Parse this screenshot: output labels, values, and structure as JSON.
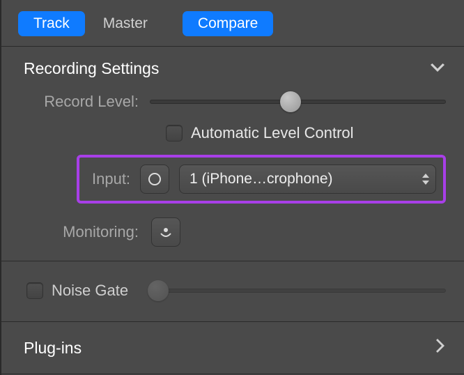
{
  "tabs": {
    "track": "Track",
    "master": "Master",
    "compare": "Compare"
  },
  "recording": {
    "title": "Recording Settings",
    "record_level_label": "Record Level:",
    "auto_level_label": "Automatic Level Control",
    "input_label": "Input:",
    "input_value": "1  (iPhone…crophone)",
    "monitoring_label": "Monitoring:",
    "record_level_pct": 44
  },
  "noise_gate": {
    "label": "Noise Gate",
    "value_pct": 0
  },
  "plugins": {
    "title": "Plug-ins"
  }
}
